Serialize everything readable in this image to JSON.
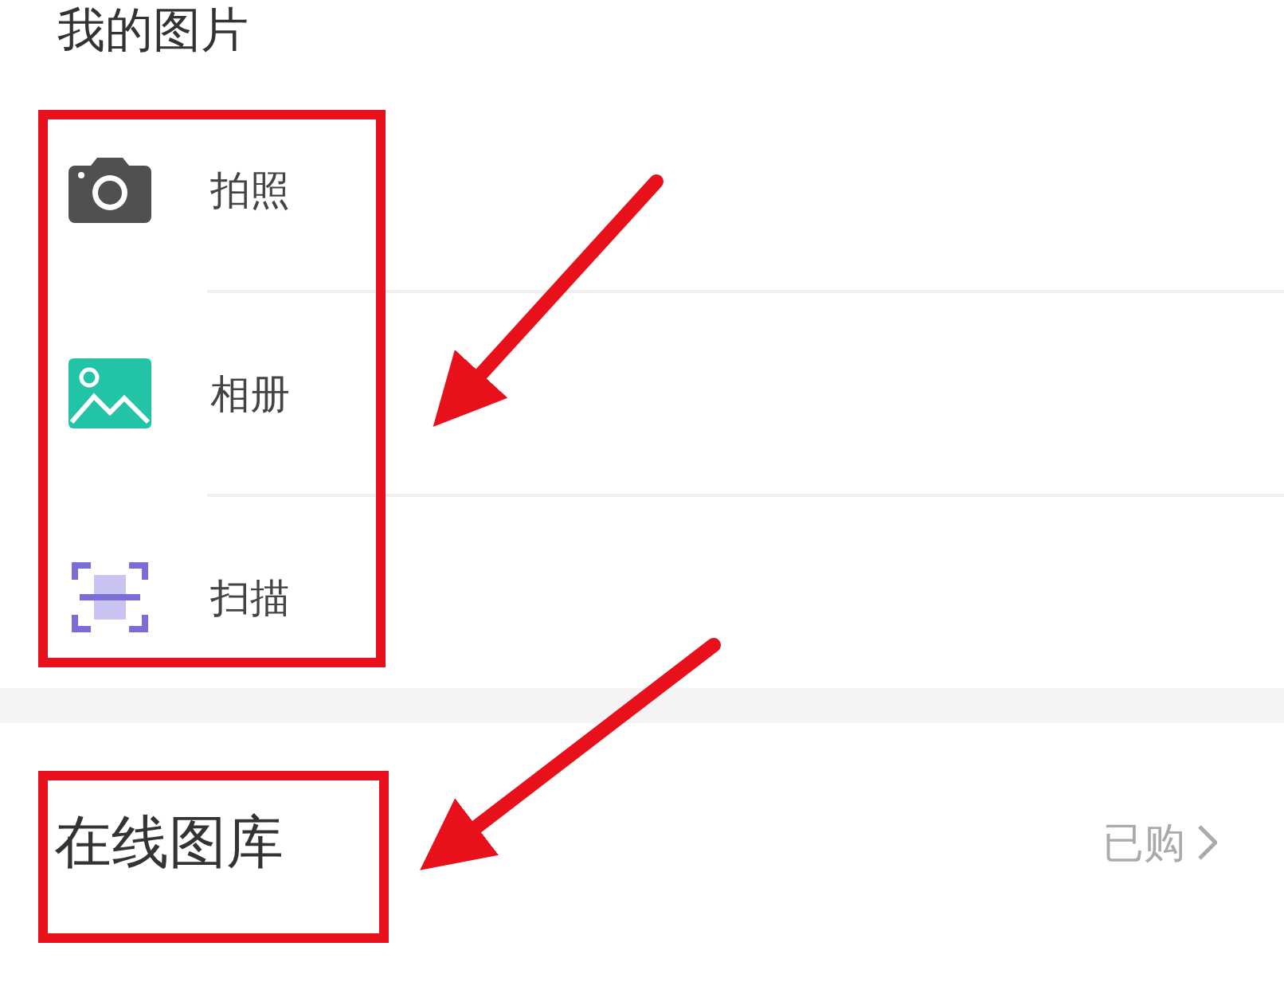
{
  "section_title": "我的图片",
  "items": [
    {
      "kind": "camera",
      "label": "拍照"
    },
    {
      "kind": "album",
      "label": "相册"
    },
    {
      "kind": "scan",
      "label": "扫描"
    }
  ],
  "online": {
    "title": "在线图库",
    "link": "已购"
  }
}
